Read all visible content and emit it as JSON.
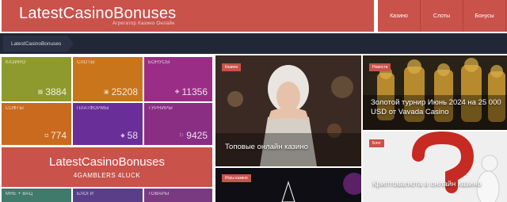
{
  "header": {
    "logo_title": "LatestCasinoBonuses",
    "logo_subtitle": "Агрегатор Казино Онлайн",
    "nav": [
      "Казино",
      "Слоты",
      "Бонусы"
    ]
  },
  "breadcrumb": {
    "current": "LatestCasinoBonuses"
  },
  "tiles": [
    {
      "label": "КАЗИНО",
      "count": "3884",
      "color": "#8e9a2e",
      "icon": "casino-icon"
    },
    {
      "label": "СЛОТЫ",
      "count": "25208",
      "color": "#c9751c",
      "icon": "slots-icon"
    },
    {
      "label": "БОНУСЫ",
      "count": "11356",
      "color": "#9a2e86",
      "icon": "bonus-icon"
    },
    {
      "label": "СОФТЫ",
      "count": "774",
      "color": "#c96a1e",
      "icon": "software-icon"
    },
    {
      "label": "ПЛАТФОРМЫ",
      "count": "58",
      "color": "#6a2e98",
      "icon": "platforms-icon"
    },
    {
      "label": "ТУРНИРЫ",
      "count": "9425",
      "color": "#8a2e84",
      "icon": "tournaments-icon"
    },
    {
      "label": "МНЕ + ВАЦ",
      "count": "",
      "color": "#3f7a6a",
      "icon": ""
    },
    {
      "label": "БЛОГИ",
      "count": "",
      "color": "#5a3f88",
      "icon": ""
    },
    {
      "label": "ТОВАРЫ",
      "count": "",
      "color": "#7a3a82",
      "icon": ""
    }
  ],
  "promo": {
    "title": "LatestCasinoBonuses",
    "subtitle": "4GAMBLERS 4LUCK"
  },
  "cards": {
    "top_casino": {
      "tag": "Казино",
      "title": "Топовые онлайн казино"
    },
    "news": {
      "tag": "Новости",
      "title": "Золотой турнир Июнь 2024 на 25 000 USD от Vavada Casino"
    },
    "blog": {
      "tag": "Блог",
      "title": "Криптовалюта в онлайн казино"
    },
    "games": {
      "tag": "Игры казино",
      "title": ""
    }
  }
}
